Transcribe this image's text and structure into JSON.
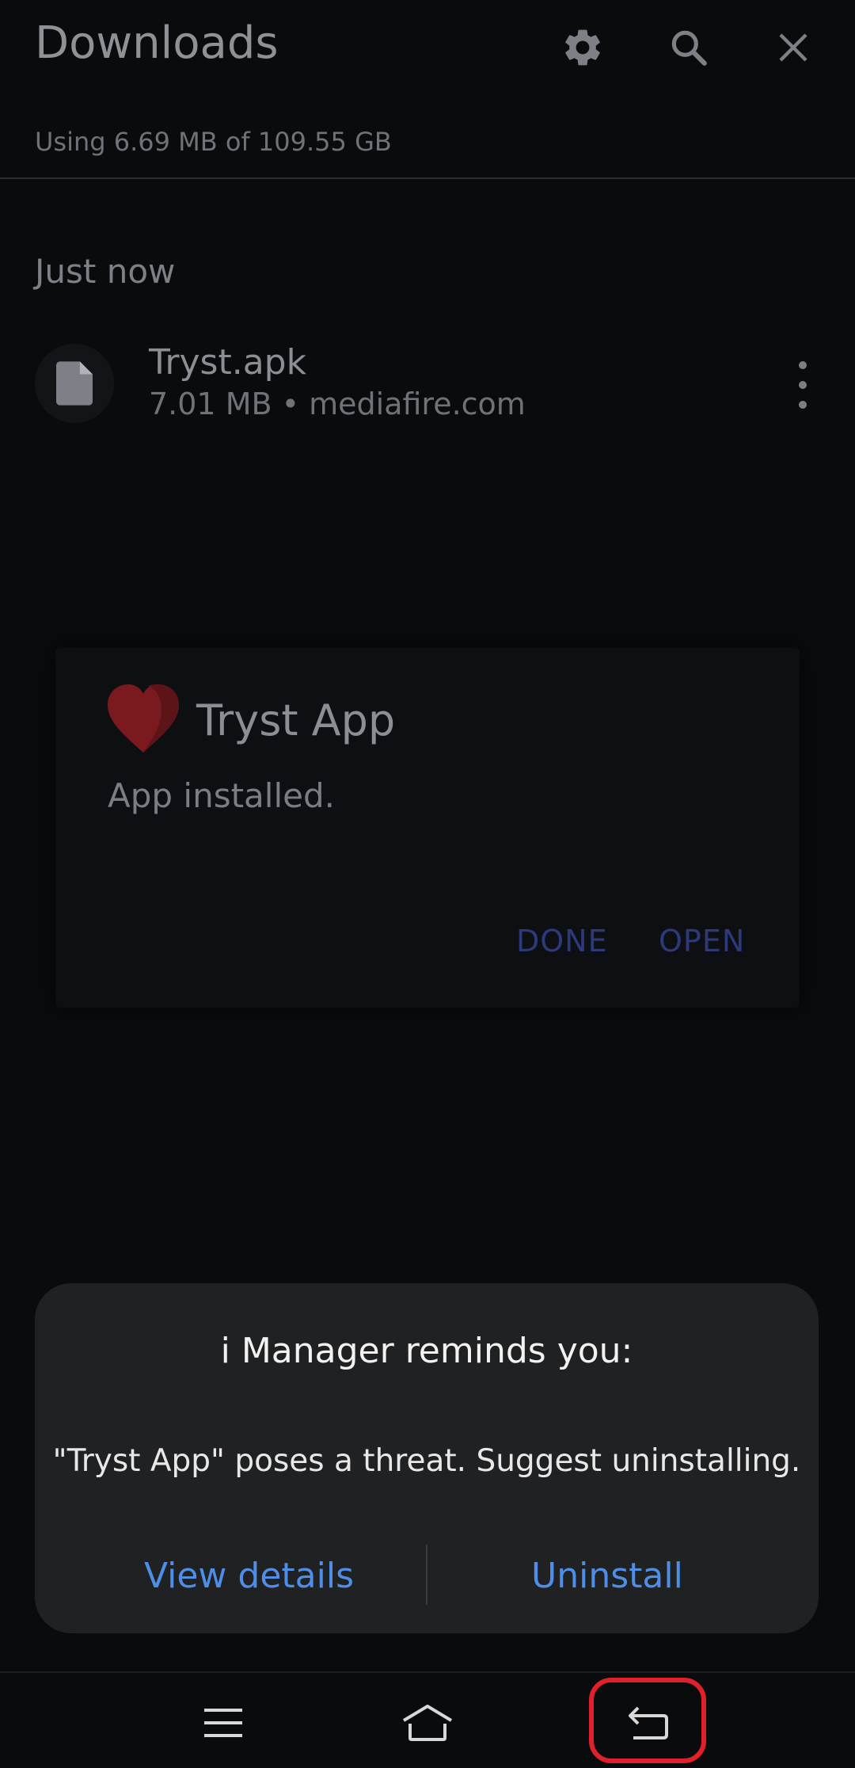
{
  "header": {
    "title": "Downloads",
    "icons": [
      "settings-icon",
      "search-icon",
      "close-icon"
    ]
  },
  "storage": {
    "text": "Using 6.69 MB of 109.55 GB"
  },
  "downloads": {
    "section_label": "Just now",
    "items": [
      {
        "name": "Tryst.apk",
        "meta": "7.01 MB • mediafire.com",
        "icon": "file-icon"
      }
    ]
  },
  "install_card": {
    "app_name": "Tryst App",
    "status": "App installed.",
    "done_label": "DONE",
    "open_label": "OPEN",
    "logo": "heart-logo"
  },
  "dialog": {
    "title": "i Manager reminds you:",
    "message": "\"Tryst App\" poses a threat. Suggest uninstalling.",
    "view_details_label": "View details",
    "uninstall_label": "Uninstall",
    "action_color": "#4f8ee6"
  },
  "nav_bar": {
    "buttons": [
      "recents-icon",
      "home-icon",
      "back-icon"
    ],
    "highlighted": "back-icon",
    "highlight_color": "#e0202a"
  }
}
